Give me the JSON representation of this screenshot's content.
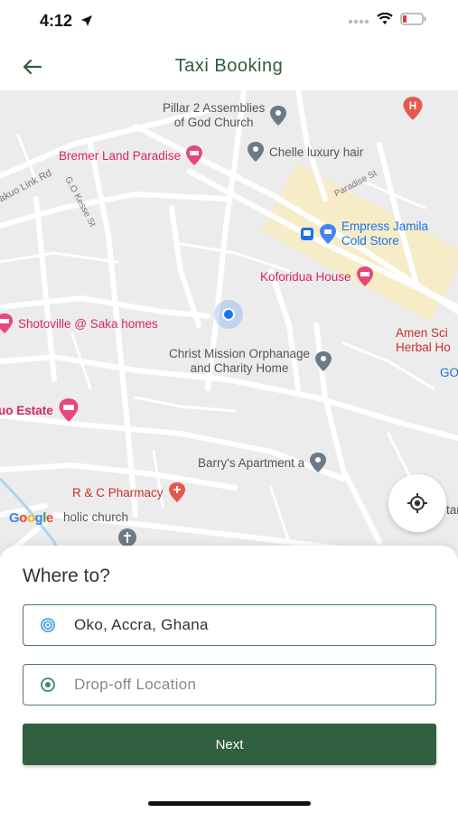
{
  "status_bar": {
    "time": "4:12"
  },
  "header": {
    "title": "Taxi Booking"
  },
  "map": {
    "pois": [
      {
        "label": "Pillar 2 Assemblies",
        "label2": "of God Church",
        "type": "gray"
      },
      {
        "label": "Bremer Land Paradise",
        "type": "red"
      },
      {
        "label": "Chelle luxury hair",
        "type": "gray"
      },
      {
        "label": "Empress Jamila",
        "label2": "Cold Store",
        "type": "blue"
      },
      {
        "label": "Koforidua House",
        "type": "red"
      },
      {
        "label": "Shotoville @ Saka homes",
        "type": "red"
      },
      {
        "label": "Amen Sci",
        "label2": "Herbal Ho",
        "type": "orange"
      },
      {
        "label": "Christ Mission Orphanage",
        "label2": "and Charity Home",
        "type": "gray"
      },
      {
        "label": "uo Estate",
        "type": "red"
      },
      {
        "label": "Barry's Apartment a",
        "type": "gray"
      },
      {
        "label": "R & C Pharmacy",
        "type": "orange"
      },
      {
        "label": "holic church",
        "type": "gray"
      }
    ],
    "streets": [
      "akuo Link Rd",
      "G.O Kesse St",
      "Paradise St"
    ],
    "edge_labels": [
      "GO",
      "tar"
    ],
    "logo": "Google"
  },
  "booking": {
    "title": "Where to?",
    "pickup_value": "Oko, Accra, Ghana",
    "dropoff_placeholder": "Drop-off Location",
    "next_label": "Next"
  },
  "colors": {
    "brand_green": "#30603f",
    "header_text": "#2e5e3c",
    "field_border": "#4d7a5c"
  }
}
